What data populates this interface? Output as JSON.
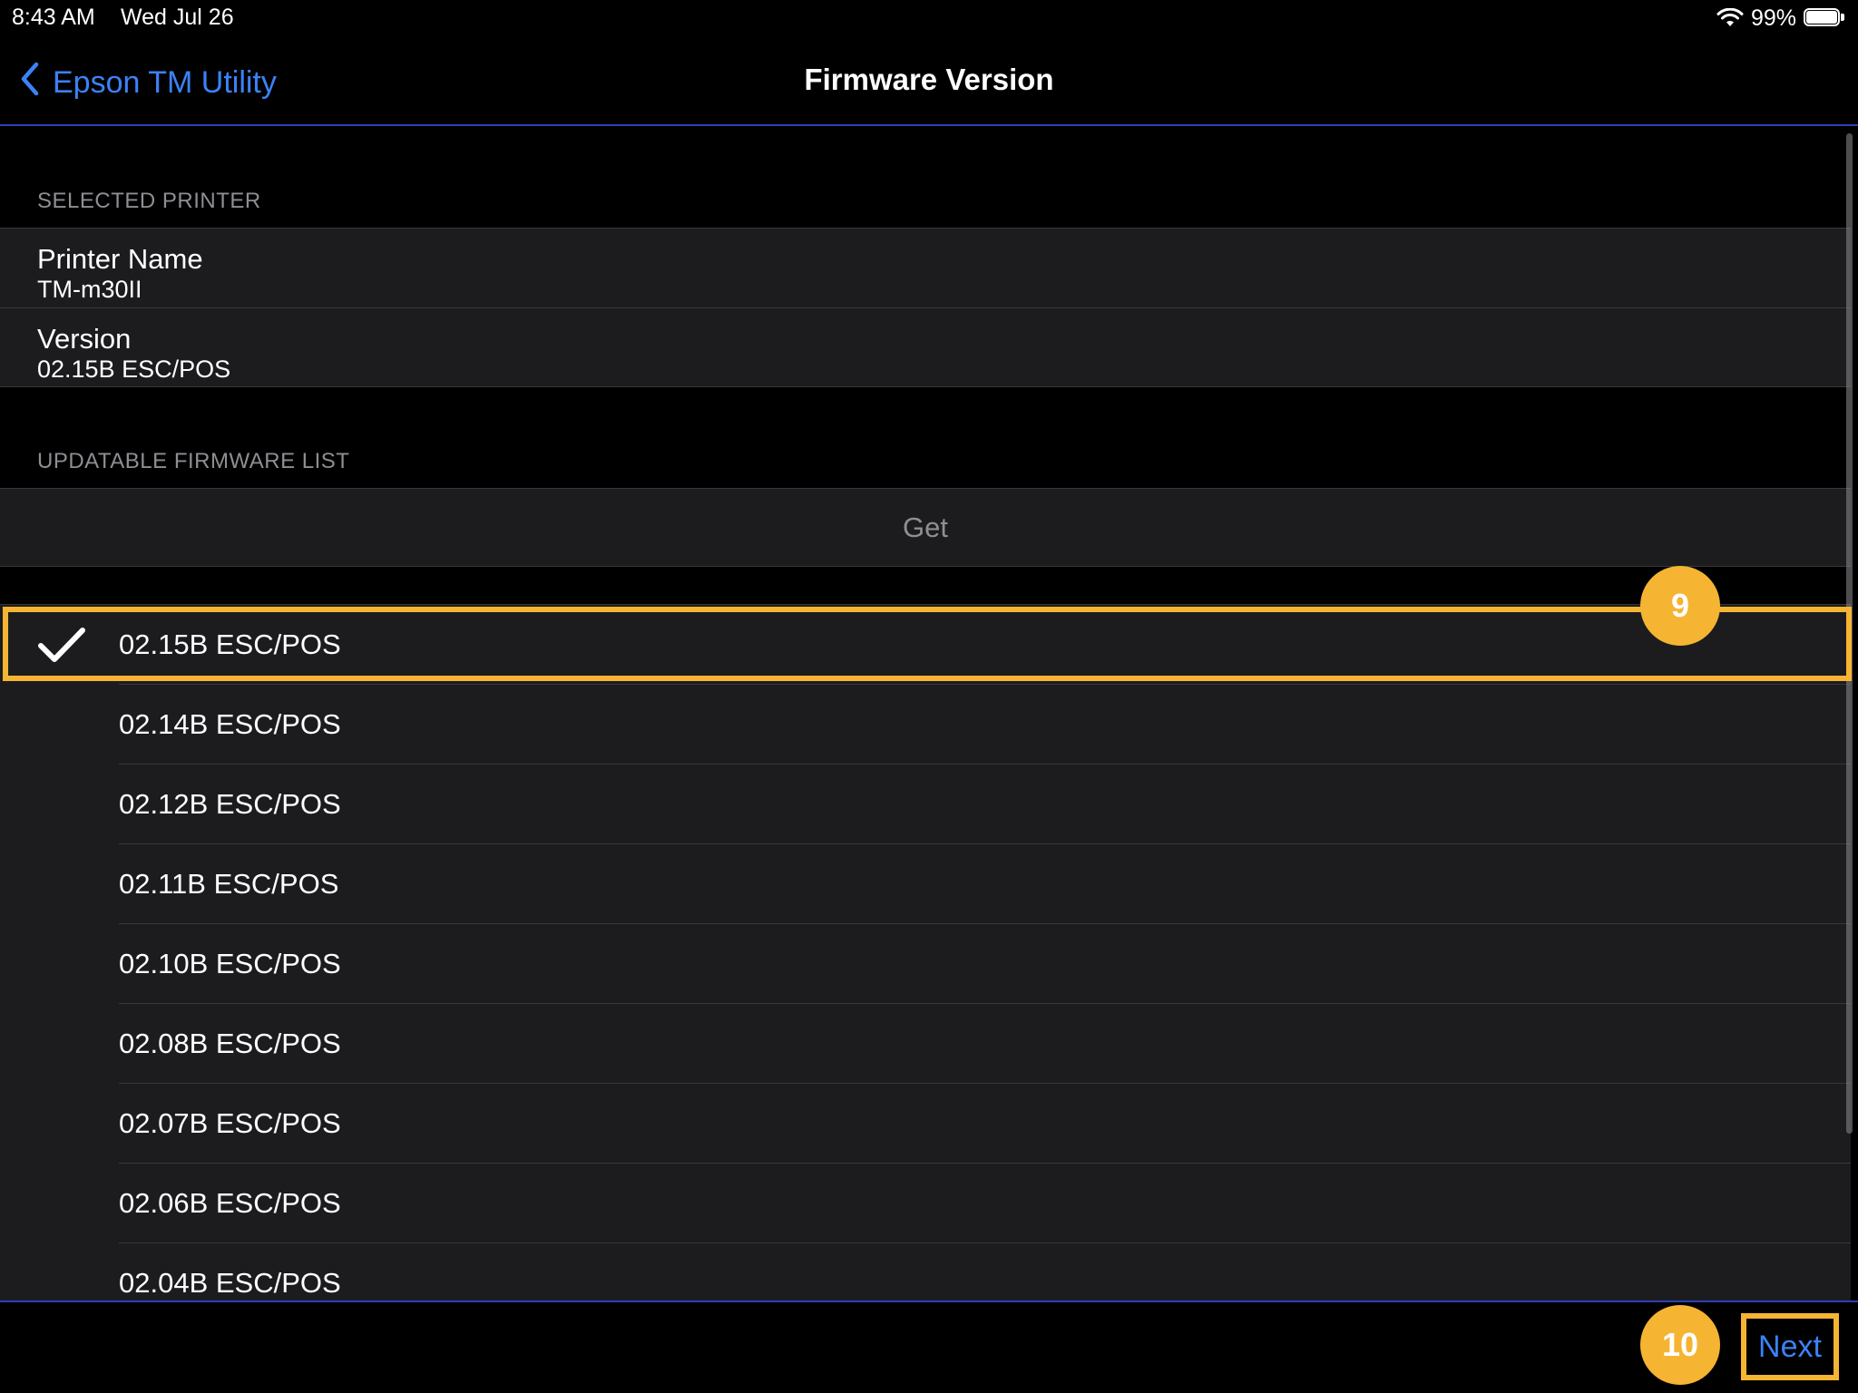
{
  "status_bar": {
    "time": "8:43 AM",
    "date": "Wed Jul 26",
    "battery_percent": "99%",
    "battery_level": 0.99,
    "icons": [
      "wifi-icon",
      "battery-icon"
    ]
  },
  "nav": {
    "back_label": "Epson TM Utility",
    "back_icon": "chevron-left-icon",
    "title": "Firmware Version"
  },
  "selected_printer": {
    "header": "SELECTED PRINTER",
    "rows": [
      {
        "title": "Printer Name",
        "value": "TM-m30II"
      },
      {
        "title": "Version",
        "value": "02.15B ESC/POS"
      }
    ]
  },
  "updatable_list": {
    "header": "UPDATABLE FIRMWARE LIST",
    "get_label": "Get",
    "items": [
      {
        "label": "02.15B ESC/POS",
        "selected": true
      },
      {
        "label": "02.14B ESC/POS",
        "selected": false
      },
      {
        "label": "02.12B ESC/POS",
        "selected": false
      },
      {
        "label": "02.11B ESC/POS",
        "selected": false
      },
      {
        "label": "02.10B ESC/POS",
        "selected": false
      },
      {
        "label": "02.08B ESC/POS",
        "selected": false
      },
      {
        "label": "02.07B ESC/POS",
        "selected": false
      },
      {
        "label": "02.06B ESC/POS",
        "selected": false
      },
      {
        "label": "02.04B ESC/POS",
        "selected": false
      }
    ]
  },
  "annotations": {
    "step_a": "9",
    "step_b": "10",
    "accent_color": "#f5b432"
  },
  "toolbar": {
    "next_label": "Next"
  },
  "colors": {
    "link": "#3b82f6",
    "cell_background": "#1c1c1e",
    "secondary_text": "#8e8e93",
    "divider_accent": "#2c3fb8"
  }
}
